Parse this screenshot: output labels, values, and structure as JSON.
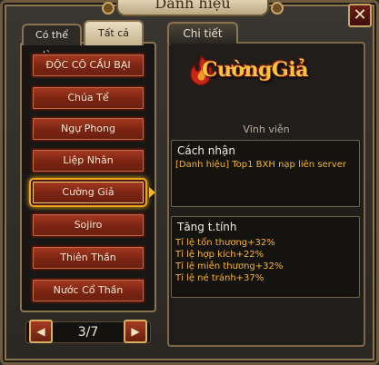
{
  "window": {
    "title": "Danh hiệu",
    "close_label": "✕"
  },
  "tabs": {
    "left": "Có thể dùng",
    "right": "Tất cả"
  },
  "titles": [
    "ĐỘC CÔ CẦU BẠI",
    "Chúa Tể",
    "Ngự Phong",
    "Liệp Nhân",
    "Cường Giả",
    "Sojiro",
    "Thiên Thần",
    "Nước Cổ Thần"
  ],
  "selected_index": 4,
  "pager": {
    "current": "3/7",
    "prev_icon": "prev-arrow-icon",
    "next_icon": "next-arrow-icon"
  },
  "detail": {
    "tab_label": "Chi tiết",
    "logo_text": "CườngGiả",
    "validity": "Vĩnh viễn",
    "acquire": {
      "title": "Cách nhận",
      "text": "[Danh hiệu] Top1 BXH nạp liên server"
    },
    "stats": {
      "title": "Tăng t.tính",
      "lines": [
        "Tỉ lệ tổn thương+32%",
        "Tỉ lệ hợp kích+22%",
        "Tỉ lệ miễn thương+32%",
        "Tỉ lệ né tránh+37%"
      ]
    }
  },
  "colors": {
    "accent_gold": "#f4b52c",
    "button_red": "#7a2412",
    "selected_glow": "#f4b41a"
  }
}
